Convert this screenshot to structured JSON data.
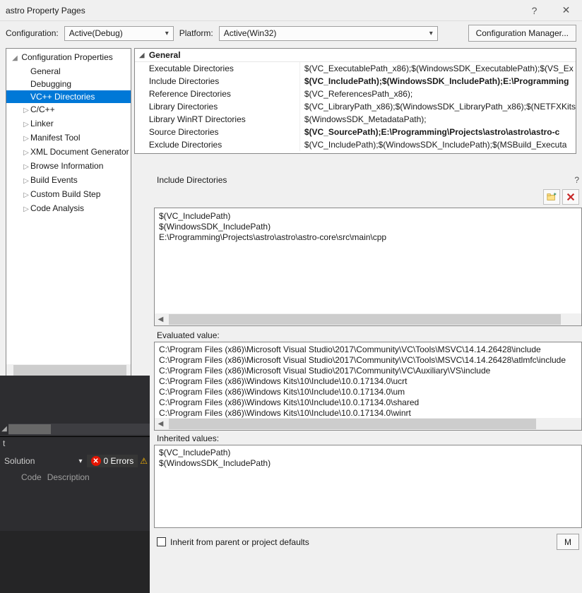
{
  "window": {
    "title": "astro Property Pages"
  },
  "config_row": {
    "config_label": "Configuration:",
    "config_value": "Active(Debug)",
    "platform_label": "Platform:",
    "platform_value": "Active(Win32)",
    "cfg_mgr": "Configuration Manager..."
  },
  "tree": {
    "root": "Configuration Properties",
    "items": [
      "General",
      "Debugging",
      "VC++ Directories",
      "C/C++",
      "Linker",
      "Manifest Tool",
      "XML Document Generator",
      "Browse Information",
      "Build Events",
      "Custom Build Step",
      "Code Analysis"
    ]
  },
  "general": {
    "section": "General",
    "rows": [
      {
        "name": "Executable Directories",
        "val": "$(VC_ExecutablePath_x86);$(WindowsSDK_ExecutablePath);$(VS_Ex",
        "bold": false
      },
      {
        "name": "Include Directories",
        "val": "$(VC_IncludePath);$(WindowsSDK_IncludePath);E:\\Programming",
        "bold": true
      },
      {
        "name": "Reference Directories",
        "val": "$(VC_ReferencesPath_x86);",
        "bold": false
      },
      {
        "name": "Library Directories",
        "val": "$(VC_LibraryPath_x86);$(WindowsSDK_LibraryPath_x86);$(NETFXKits",
        "bold": false
      },
      {
        "name": "Library WinRT Directories",
        "val": "$(WindowsSDK_MetadataPath);",
        "bold": false
      },
      {
        "name": "Source Directories",
        "val": "$(VC_SourcePath);E:\\Programming\\Projects\\astro\\astro\\astro-c",
        "bold": true
      },
      {
        "name": "Exclude Directories",
        "val": "$(VC_IncludePath);$(WindowsSDK_IncludePath);$(MSBuild_Executa",
        "bold": false
      }
    ]
  },
  "sub": {
    "title": "Include Directories",
    "edit_lines": [
      "$(VC_IncludePath)",
      "$(WindowsSDK_IncludePath)",
      "E:\\Programming\\Projects\\astro\\astro\\astro-core\\src\\main\\cpp"
    ],
    "evaluated_label": "Evaluated value:",
    "evaluated_lines": [
      "C:\\Program Files (x86)\\Microsoft Visual Studio\\2017\\Community\\VC\\Tools\\MSVC\\14.14.26428\\include",
      "C:\\Program Files (x86)\\Microsoft Visual Studio\\2017\\Community\\VC\\Tools\\MSVC\\14.14.26428\\atlmfc\\include",
      "C:\\Program Files (x86)\\Microsoft Visual Studio\\2017\\Community\\VC\\Auxiliary\\VS\\include",
      "C:\\Program Files (x86)\\Windows Kits\\10\\Include\\10.0.17134.0\\ucrt",
      "C:\\Program Files (x86)\\Windows Kits\\10\\Include\\10.0.17134.0\\um",
      "C:\\Program Files (x86)\\Windows Kits\\10\\Include\\10.0.17134.0\\shared",
      "C:\\Program Files (x86)\\Windows Kits\\10\\Include\\10.0.17134.0\\winrt"
    ],
    "inherited_label": "Inherited values:",
    "inherited_lines": [
      "$(VC_IncludePath)",
      "$(WindowsSDK_IncludePath)"
    ],
    "inherit_checkbox": "Inherit from parent or project defaults",
    "macros_btn": "M"
  },
  "ide": {
    "t_prefix": "t",
    "solution": "Solution",
    "errors_count": "0 Errors",
    "warn_icon": "⚠",
    "col1": "Code",
    "col2": "Description"
  }
}
